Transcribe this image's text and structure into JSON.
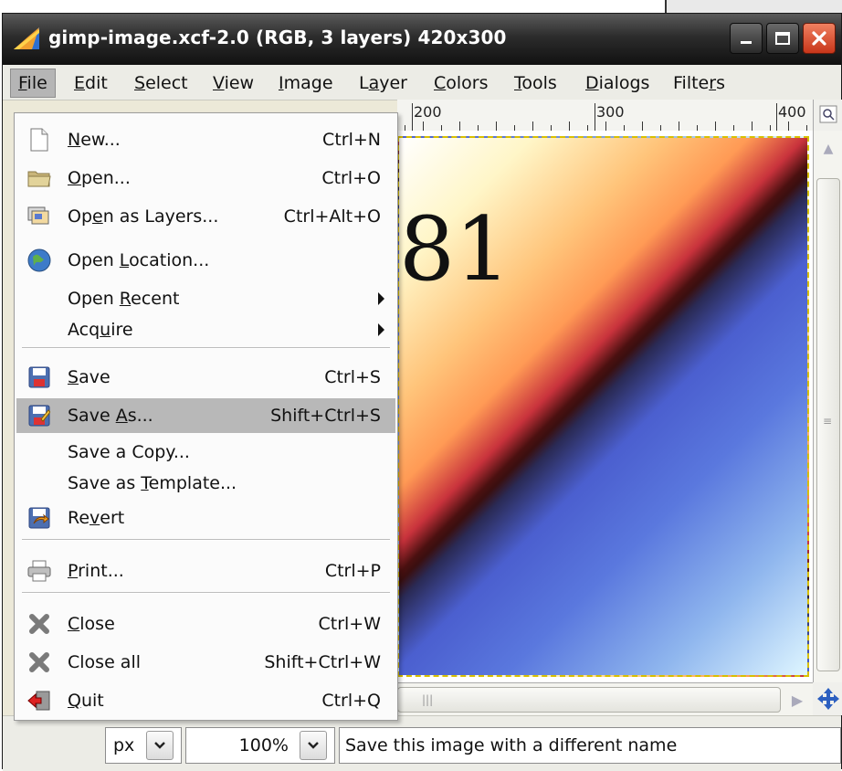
{
  "window": {
    "title": "gimp-image.xcf-2.0 (RGB, 3 layers) 420x300"
  },
  "menubar": [
    {
      "label": "File",
      "mnemonic_index": 0
    },
    {
      "label": "Edit",
      "mnemonic_index": 0
    },
    {
      "label": "Select",
      "mnemonic_index": 0
    },
    {
      "label": "View",
      "mnemonic_index": 0
    },
    {
      "label": "Image",
      "mnemonic_index": 0
    },
    {
      "label": "Layer",
      "mnemonic_index": 1
    },
    {
      "label": "Colors",
      "mnemonic_index": 0
    },
    {
      "label": "Tools",
      "mnemonic_index": 0
    },
    {
      "label": "Dialogs",
      "mnemonic_index": 0
    },
    {
      "label": "Filters",
      "mnemonic_index": 5
    }
  ],
  "ruler": {
    "labels": [
      "200",
      "300",
      "400"
    ]
  },
  "canvas": {
    "visible_text": "81",
    "colors": [
      "#fff6c8",
      "#ff9a55",
      "#c8323c",
      "#3a0f10",
      "#4b5fcf",
      "#dff6ff"
    ]
  },
  "file_menu": {
    "items": [
      {
        "label": "New...",
        "accel": "Ctrl+N",
        "icon": "new-document-icon"
      },
      {
        "label": "Open...",
        "accel": "Ctrl+O",
        "icon": "folder-open-icon"
      },
      {
        "label": "Open as Layers...",
        "accel": "Ctrl+Alt+O",
        "icon": "open-as-layers-icon"
      },
      {
        "label": "Open Location...",
        "accel": "",
        "icon": "globe-icon"
      },
      {
        "label": "Open Recent",
        "accel": "",
        "icon": "",
        "submenu": true
      },
      {
        "label": "Acquire",
        "accel": "",
        "icon": "",
        "submenu": true
      },
      {
        "label": "Save",
        "accel": "Ctrl+S",
        "icon": "save-icon"
      },
      {
        "label": "Save As...",
        "accel": "Shift+Ctrl+S",
        "icon": "save-as-icon",
        "highlighted": true
      },
      {
        "label": "Save a Copy...",
        "accel": "",
        "icon": ""
      },
      {
        "label": "Save as Template...",
        "accel": "",
        "icon": ""
      },
      {
        "label": "Revert",
        "accel": "",
        "icon": "revert-icon"
      },
      {
        "label": "Print...",
        "accel": "Ctrl+P",
        "icon": "print-icon"
      },
      {
        "label": "Close",
        "accel": "Ctrl+W",
        "icon": "close-x-icon"
      },
      {
        "label": "Close all",
        "accel": "Shift+Ctrl+W",
        "icon": "close-x-icon"
      },
      {
        "label": "Quit",
        "accel": "Ctrl+Q",
        "icon": "quit-icon"
      }
    ]
  },
  "statusbar": {
    "unit": "px",
    "zoom": "100%",
    "message": "Save this image with a different name"
  }
}
